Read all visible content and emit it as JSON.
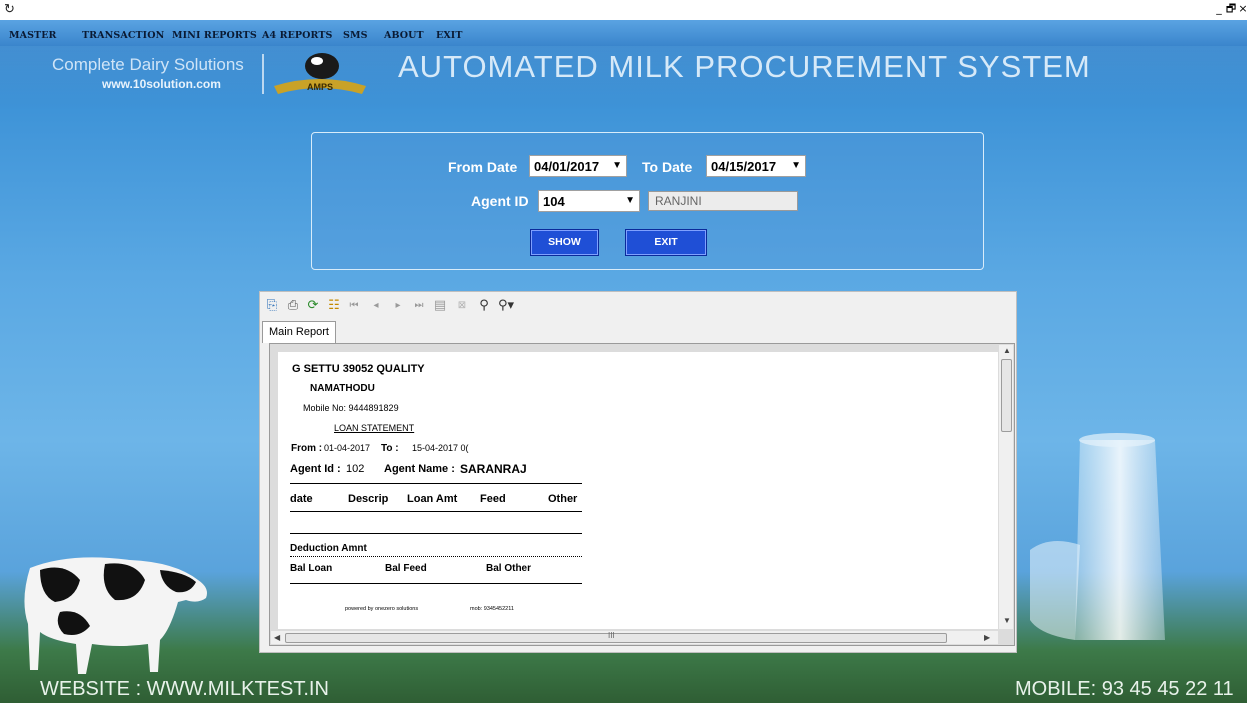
{
  "window": {
    "app_icon": "app-icon",
    "controls": [
      "_",
      "🗗",
      "×"
    ]
  },
  "menu": {
    "items": [
      "MASTER",
      "TRANSACTION",
      "MINI REPORTS",
      "A4 REPORTS",
      "SMS",
      "ABOUT",
      "EXIT"
    ]
  },
  "banner": {
    "tagline": "Complete Dairy Solutions",
    "url": "www.10solution.com",
    "logo_text": "AMPS",
    "title": "AUTOMATED MILK PROCUREMENT SYSTEM"
  },
  "filter": {
    "from_label": "From Date",
    "from_value": "04/01/2017",
    "to_label": "To Date",
    "to_value": "04/15/2017",
    "agent_label": "Agent ID",
    "agent_value": "104",
    "agent_name": "RANJINI",
    "show_label": "SHOW",
    "exit_label": "EXIT"
  },
  "viewer": {
    "toolbar_icons": [
      "export-icon",
      "print-icon",
      "refresh-icon",
      "group-tree-icon",
      "first-page-icon",
      "previous-page-icon",
      "next-page-icon",
      "last-page-icon",
      "goto-page-icon",
      "stop-icon",
      "search-icon",
      "zoom-icon"
    ],
    "tab_label": "Main Report",
    "report": {
      "line1": "G SETTU 39052 QUALITY",
      "line2": "NAMATHODU",
      "mobile": "Mobile No: 9444891829",
      "heading": "LOAN STATEMENT",
      "from_label": "From :",
      "from_value": "01-04-2017",
      "to_label": "To :",
      "to_value": "15-04-2017 0(",
      "agent_id_label": "Agent Id :",
      "agent_id_value": "102",
      "agent_name_label": "Agent Name :",
      "agent_name_value": "SARANRAJ",
      "columns": [
        "date",
        "Descrip",
        "Loan Amt",
        "Feed",
        "Other"
      ],
      "deduction_label": "Deduction Amnt",
      "balances": [
        "Bal Loan",
        "Bal Feed",
        "Bal Other"
      ],
      "powered_by": "powered by onezero solutions",
      "powered_mob": "mob: 9345452211"
    },
    "hscroll_marker": "III"
  },
  "footer": {
    "website": "WEBSITE : WWW.MILKTEST.IN",
    "mobile": "MOBILE: 93 45 45 22 11"
  },
  "colors": {
    "menu_bg": "#4a96dc",
    "button_bg": "#1f4fd6",
    "sky": "#5aa8e3",
    "grass": "#2f5e34"
  }
}
